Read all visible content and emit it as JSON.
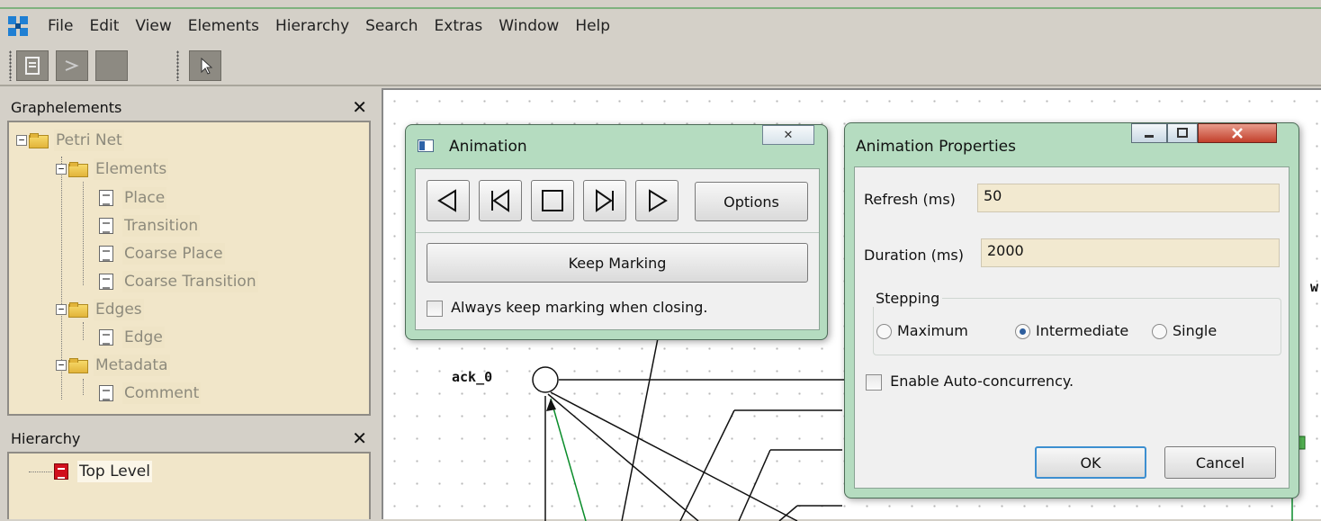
{
  "menu": {
    "items": [
      "File",
      "Edit",
      "View",
      "Elements",
      "Hierarchy",
      "Search",
      "Extras",
      "Window",
      "Help"
    ]
  },
  "toolbar": {
    "icons": [
      "document-icon",
      "arrow-icon",
      "blank-icon",
      "pointer-icon"
    ]
  },
  "graphelements_panel": {
    "title": "Graphelements",
    "close_glyph": "✕",
    "tree": {
      "root": "Petri Net",
      "elements": "Elements",
      "place": "Place",
      "transition": "Transition",
      "coarse_place": "Coarse Place",
      "coarse_transition": "Coarse Transition",
      "edges": "Edges",
      "edge": "Edge",
      "metadata": "Metadata",
      "comment": "Comment"
    }
  },
  "hierarchy_panel": {
    "title": "Hierarchy",
    "close_glyph": "✕",
    "top_level": "Top Level"
  },
  "canvas": {
    "place_label": "ack_0",
    "right_edge_label": "w"
  },
  "animation_dialog": {
    "title": "Animation",
    "close_glyph": "✕",
    "options_label": "Options",
    "keep_marking_label": "Keep Marking",
    "always_keep_label": "Always keep marking when closing.",
    "always_keep_checked": false
  },
  "properties_dialog": {
    "title": "Animation Properties",
    "refresh_label": "Refresh (ms)",
    "refresh_value": "50",
    "duration_label": "Duration (ms)",
    "duration_value": "2000",
    "stepping_label": "Stepping",
    "stepping_options": [
      "Maximum",
      "Intermediate",
      "Single"
    ],
    "stepping_selected": "Intermediate",
    "auto_concurrency_label": "Enable Auto-concurrency.",
    "ok_label": "OK",
    "cancel_label": "Cancel"
  }
}
